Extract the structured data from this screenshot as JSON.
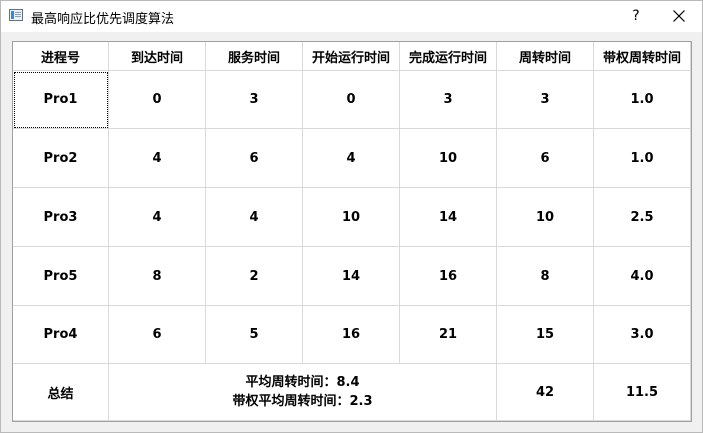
{
  "window": {
    "title": "最高响应比优先调度算法",
    "help_label": "?"
  },
  "table": {
    "headers": [
      "进程号",
      "到达时间",
      "服务时间",
      "开始运行时间",
      "完成运行时间",
      "周转时间",
      "带权周转时间"
    ],
    "rows": [
      [
        "Pro1",
        "0",
        "3",
        "0",
        "3",
        "3",
        "1.0"
      ],
      [
        "Pro2",
        "4",
        "6",
        "4",
        "10",
        "6",
        "1.0"
      ],
      [
        "Pro3",
        "4",
        "4",
        "10",
        "14",
        "10",
        "2.5"
      ],
      [
        "Pro5",
        "8",
        "2",
        "14",
        "16",
        "8",
        "4.0"
      ],
      [
        "Pro4",
        "6",
        "5",
        "16",
        "21",
        "15",
        "3.0"
      ]
    ],
    "summary": {
      "label": "总结",
      "avg_turnaround": "平均周转时间：8.4",
      "avg_weighted_turnaround": "带权平均周转时间：2.3",
      "total_turnaround": "42",
      "total_weighted_turnaround": "11.5"
    }
  }
}
